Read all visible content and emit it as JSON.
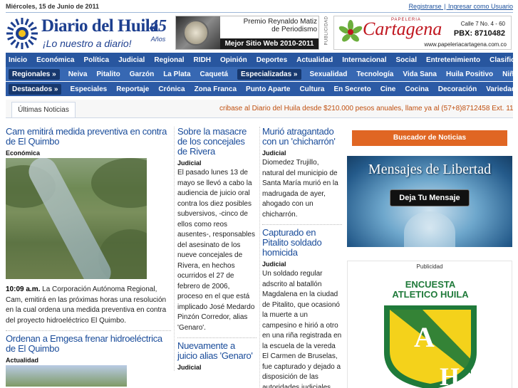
{
  "topbar": {
    "date": "Miércoles, 15 de Junio de 2011",
    "register": "Registrarse",
    "separator": "|",
    "login": "Ingresar como Usuario"
  },
  "logo": {
    "name": "Diario del Huila",
    "slogan": "¡Lo nuestro a diario!",
    "years_number": "45",
    "years_label": "Años"
  },
  "award": {
    "line1": "Premio Reynaldo Matiz",
    "line2": "de Periodismo",
    "banner": "Mejor Sitio Web 2010-2011"
  },
  "publicidad_vertical": "PUBLICIDAD",
  "cartagena_ad": {
    "sub": "PAPELERIA",
    "brand": "Cartagena",
    "address": "Calle 7 No. 4 - 60",
    "pbx": "PBX: 8710482",
    "web": "www.papeleriacartagena.com.co"
  },
  "nav": {
    "main": [
      "Inicio",
      "Económica",
      "Política",
      "Judicial",
      "Regional",
      "RIDH",
      "Opinión",
      "Deportes",
      "Actualidad",
      "Internacional",
      "Social",
      "Entretenimiento",
      "Clasificados"
    ],
    "regionales_label": "Regionales »",
    "regionales": [
      "Neiva",
      "Pitalito",
      "Garzón",
      "La Plata",
      "Caquetá"
    ],
    "especializadas_label": "Especializadas »",
    "especializadas": [
      "Sexualidad",
      "Tecnología",
      "Vida Sana",
      "Huila Positivo",
      "Niños"
    ],
    "destacados_label": "Destacados »",
    "destacados": [
      "Especiales",
      "Reportaje",
      "Crónica",
      "Zona Franca",
      "Punto Aparte",
      "Cultura",
      "En Secreto",
      "Cine",
      "Cocina",
      "Decoración",
      "Variedades"
    ]
  },
  "ticker": {
    "tab": "Últimas Noticias",
    "message": "cribase al Diario del Huila desde $210.000 pesos anuales, llame ya al (57+8)8712458 Ext. 114 o 11"
  },
  "col1": {
    "a1_title": "Cam emitirá medida preventiva en contra de El Quimbo",
    "a1_section": "Económica",
    "a1_time": "10:09 a.m.",
    "a1_body": " La Corporación Autónoma Regional, Cam, emitirá en las próximas horas una resolución en la cual ordena una medida preventiva en contra del proyecto hidroeléctrico El Quimbo.",
    "a2_title": "Ordenan a Emgesa frenar hidroeléctrica de El Quimbo",
    "a2_section": "Actualidad"
  },
  "col2": {
    "a1_title": "Sobre la masacre de los concejales de Rivera",
    "a1_section": "Judicial",
    "a1_body": "El pasado lunes 13 de mayo se llevó a cabo la audiencia de juicio oral contra los diez posibles subversivos, -cinco de ellos como reos ausentes-, responsables del asesinato de los nueve concejales de Rivera, en hechos ocurridos el 27 de febrero de 2006, proceso en el que está implicado José Medardo Pinzón Corredor, alias 'Genaro'.",
    "a2_title": "Nuevamente a juicio alias 'Genaro'",
    "a2_section": "Judicial"
  },
  "col3": {
    "a1_title": "Murió atragantado con un 'chicharrón'",
    "a1_section": "Judicial",
    "a1_body": "Diomedez Trujillo, natural del municipio de Santa María murió en la madrugada de ayer, ahogado con un chicharrón.",
    "a2_title": "Capturado en Pitalito soldado homicida",
    "a2_section": "Judicial",
    "a2_body": "Un soldado regular adscrito al batallón Magdalena en la ciudad de Pitalito, que ocasionó la muerte a un campesino e hirió a otro en una riña registrada en la escuela de la vereda El Carmen de Bruselas, fue capturado y dejado a disposición de las autoridades judiciales."
  },
  "sidebar": {
    "search_button": "Buscador de Noticias",
    "libertad_title": "Mensajes de Libertad",
    "libertad_button": "Deja Tu Mensaje",
    "publicidad": "Publicidad",
    "encuesta_line1": "ENCUESTA",
    "encuesta_line2": "ATLETICO HUILA",
    "shield_letters": [
      "A",
      "H"
    ]
  },
  "colors": {
    "nav": "#2c5aa5",
    "headline": "#1a4c9a",
    "orange_button": "#e06623",
    "brand_red": "#c0161f"
  }
}
